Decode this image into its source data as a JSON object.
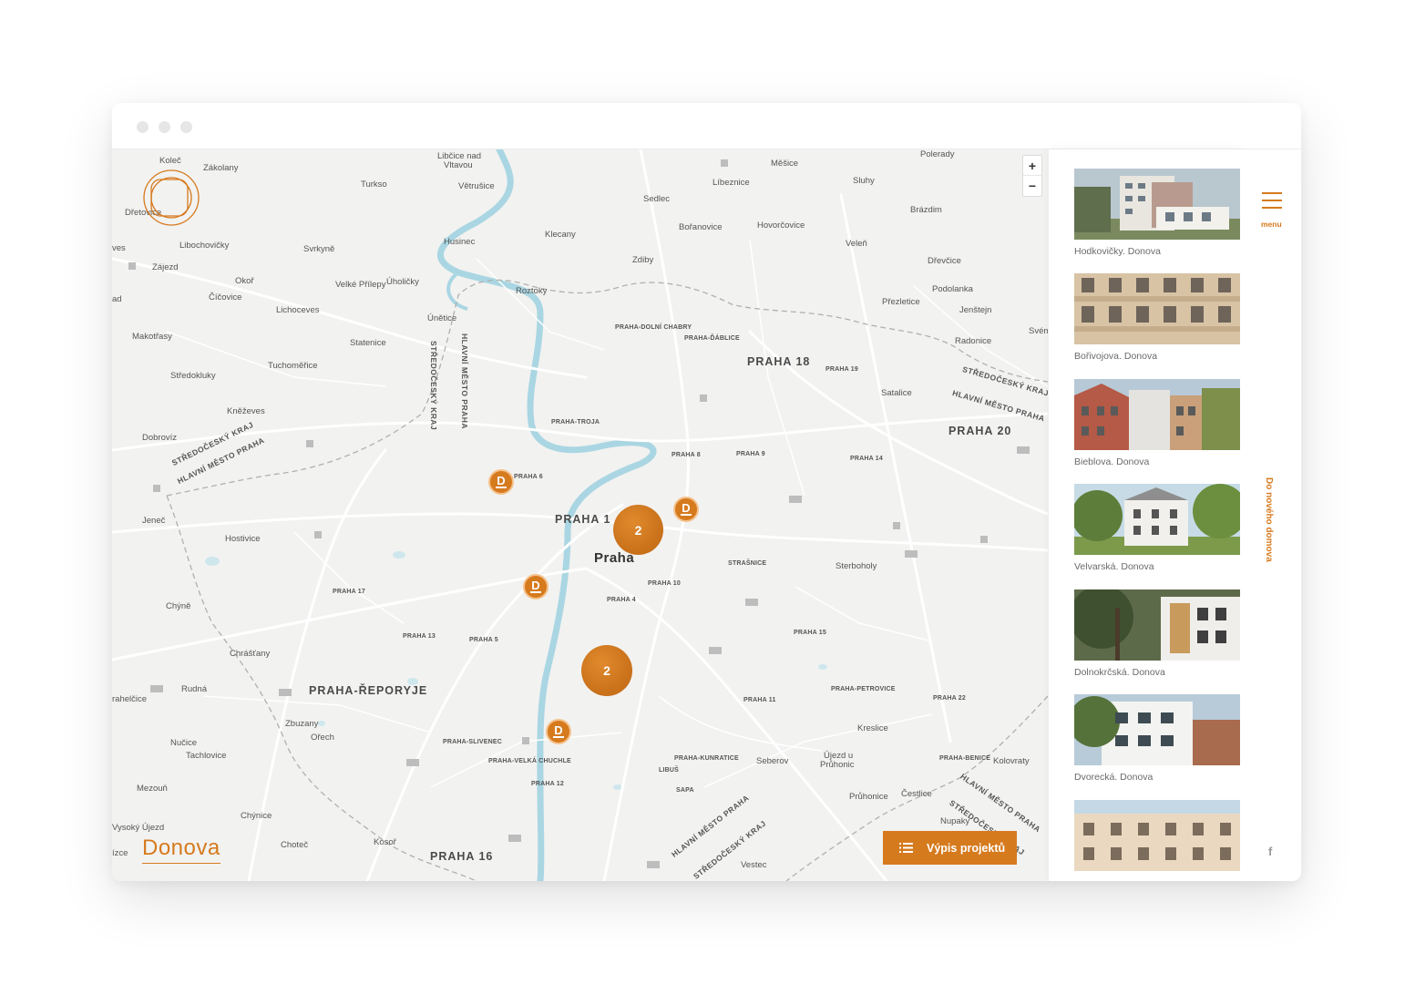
{
  "window": {
    "controls": [
      "close",
      "minimize",
      "maximize"
    ]
  },
  "map": {
    "zoom": {
      "in": "+",
      "out": "−"
    },
    "city_label": "Praha",
    "districts_big": [
      "PRAHA 1",
      "PRAHA 18",
      "PRAHA 20",
      "PRAHA-ŘEPORYJE",
      "PRAHA 16"
    ],
    "places": {
      "kolec": "Koleč",
      "zakolany": "Zákolany",
      "libcice": "Libčice nad",
      "vltavou": "Vltavou",
      "turkso": "Turkso",
      "vetrusice": "Větrušice",
      "dretovice": "Dřetovice",
      "libochovicky": "Libochovičky",
      "svrkyne": "Svrkyně",
      "husinec": "Husinec",
      "klecany": "Klecany",
      "sedlec": "Sedlec",
      "libeznice": "Líbeznice",
      "mesice": "Měšice",
      "polerady": "Polerady",
      "sluhy": "Sluhy",
      "brazdim": "Brázdim",
      "boranovice": "Bořanovice",
      "hovorcovice": "Hovorčovice",
      "zajezd": "Zájezd",
      "okor": "Okoř",
      "velke_prilepy": "Velké Přílepy",
      "uholicky": "Úholičky",
      "zdiby": "Zdiby",
      "veleni": "Veleň",
      "drevcice": "Dřevčice",
      "cicovice": "Číčovice",
      "roztoky": "Roztoky",
      "lichoceves": "Lichoceves",
      "podolanka": "Podolanka",
      "prezletice": "Přezletice",
      "jenstejn": "Jenštejn",
      "unetice": "Únětice",
      "makotrasy": "Makotřasy",
      "statenice": "Statenice",
      "radonice": "Radonice",
      "tuchomerice": "Tuchoměřice",
      "stredokluky": "Středokluky",
      "satalice": "Satalice",
      "knezeves": "Kněževes",
      "dobrovi": "Dobrovíz",
      "jenec": "Jeneč",
      "hostivice": "Hostivice",
      "sterboholy": "Sterboholy",
      "chyne": "Chýně",
      "chrastany": "Chrášťany",
      "rudna": "Rudná",
      "zbuzany": "Zbuzany",
      "orech": "Ořech",
      "kreslice": "Kreslice",
      "nucice": "Nučice",
      "tachlovice": "Tachlovice",
      "sebero": "Seberov",
      "ujezd": "Újezd u",
      "pruhonic": "Průhonic",
      "kolovraty": "Kolovraty",
      "mezoun": "Mezouň",
      "pruhonice": "Průhonice",
      "cestlice": "Čestlice",
      "nupaky": "Nupaky",
      "chynice": "Chýnice",
      "chotec": "Choteč",
      "kosor": "Kosoř",
      "vestec": "Vestec",
      "svem": "Svém",
      "prahelcice": "rahelčice",
      "vysoky": "Vysoký Újezd",
      "ves": "ves",
      "ad": "ad",
      "zce": "ízce"
    },
    "districts_small": {
      "dolni_chabry": "PRAHA-DOLNÍ CHABRY",
      "dablice": "PRAHA-ĎÁBLICE",
      "praha19": "PRAHA 19",
      "troja": "PRAHA-TROJA",
      "praha8": "PRAHA 8",
      "praha9": "PRAHA 9",
      "praha14": "PRAHA 14",
      "praha6": "PRAHA 6",
      "praha17": "PRAHA 17",
      "praha13": "PRAHA 13",
      "praha5": "PRAHA 5",
      "praha10": "PRAHA 10",
      "praha4": "PRAHA 4",
      "strasnice": "STRAŠNICE",
      "praha15": "PRAHA 15",
      "praha11": "PRAHA 11",
      "petrovice": "PRAHA-PETROVICE",
      "praha22": "PRAHA 22",
      "slivenec": "PRAHA-SLIVENEC",
      "velka_chuchle": "PRAHA-VELKÁ CHUCHLE",
      "kunratice": "PRAHA-KUNRATICE",
      "benice": "PRAHA-BENICE",
      "praha12": "PRAHA 12",
      "libus": "LIBUŠ",
      "sapa": "SAPA"
    },
    "boundaries": {
      "sk1": "STŘEDOČESKÝ KRAJ",
      "hmp1": "HLAVNÍ MĚSTO PRAHA",
      "sk_vert": "STŘEDOČESKÝ KRAJ",
      "hmp_vert": "HLAVNÍ MĚSTO PRAHA",
      "sk2": "STŘEDOČESKÝ KRAJ",
      "hmp2": "HLAVNÍ MĚSTO PRAHA",
      "hmp3": "HLAVNÍ MĚSTO PRAHA",
      "sk3": "STŘEDOČESKÝ KRAJ",
      "hmp4": "HLAVNÍ MĚSTO PRAHA",
      "sk4": "STŘEDOČESKÝ KRAJ"
    },
    "markers": {
      "single_glyph": "D",
      "cluster1_count": "2",
      "cluster2_count": "2"
    },
    "brand": "Donova",
    "list_button": "Výpis projektů"
  },
  "projects": [
    {
      "label": "Hodkovičky. Donova"
    },
    {
      "label": "Bořivojova. Donova"
    },
    {
      "label": "Bieblova. Donova"
    },
    {
      "label": "Velvarská. Donova"
    },
    {
      "label": "Dolnokrčská. Donova"
    },
    {
      "label": "Dvorecká. Donova"
    },
    {
      "label": ""
    }
  ],
  "rightbar": {
    "menu_label": "menu",
    "vertical_link": "Do nového domova",
    "facebook_glyph": "f"
  },
  "colors": {
    "accent": "#d67a1e",
    "map_bg": "#f2f2f1",
    "water": "#a9d6e2"
  }
}
